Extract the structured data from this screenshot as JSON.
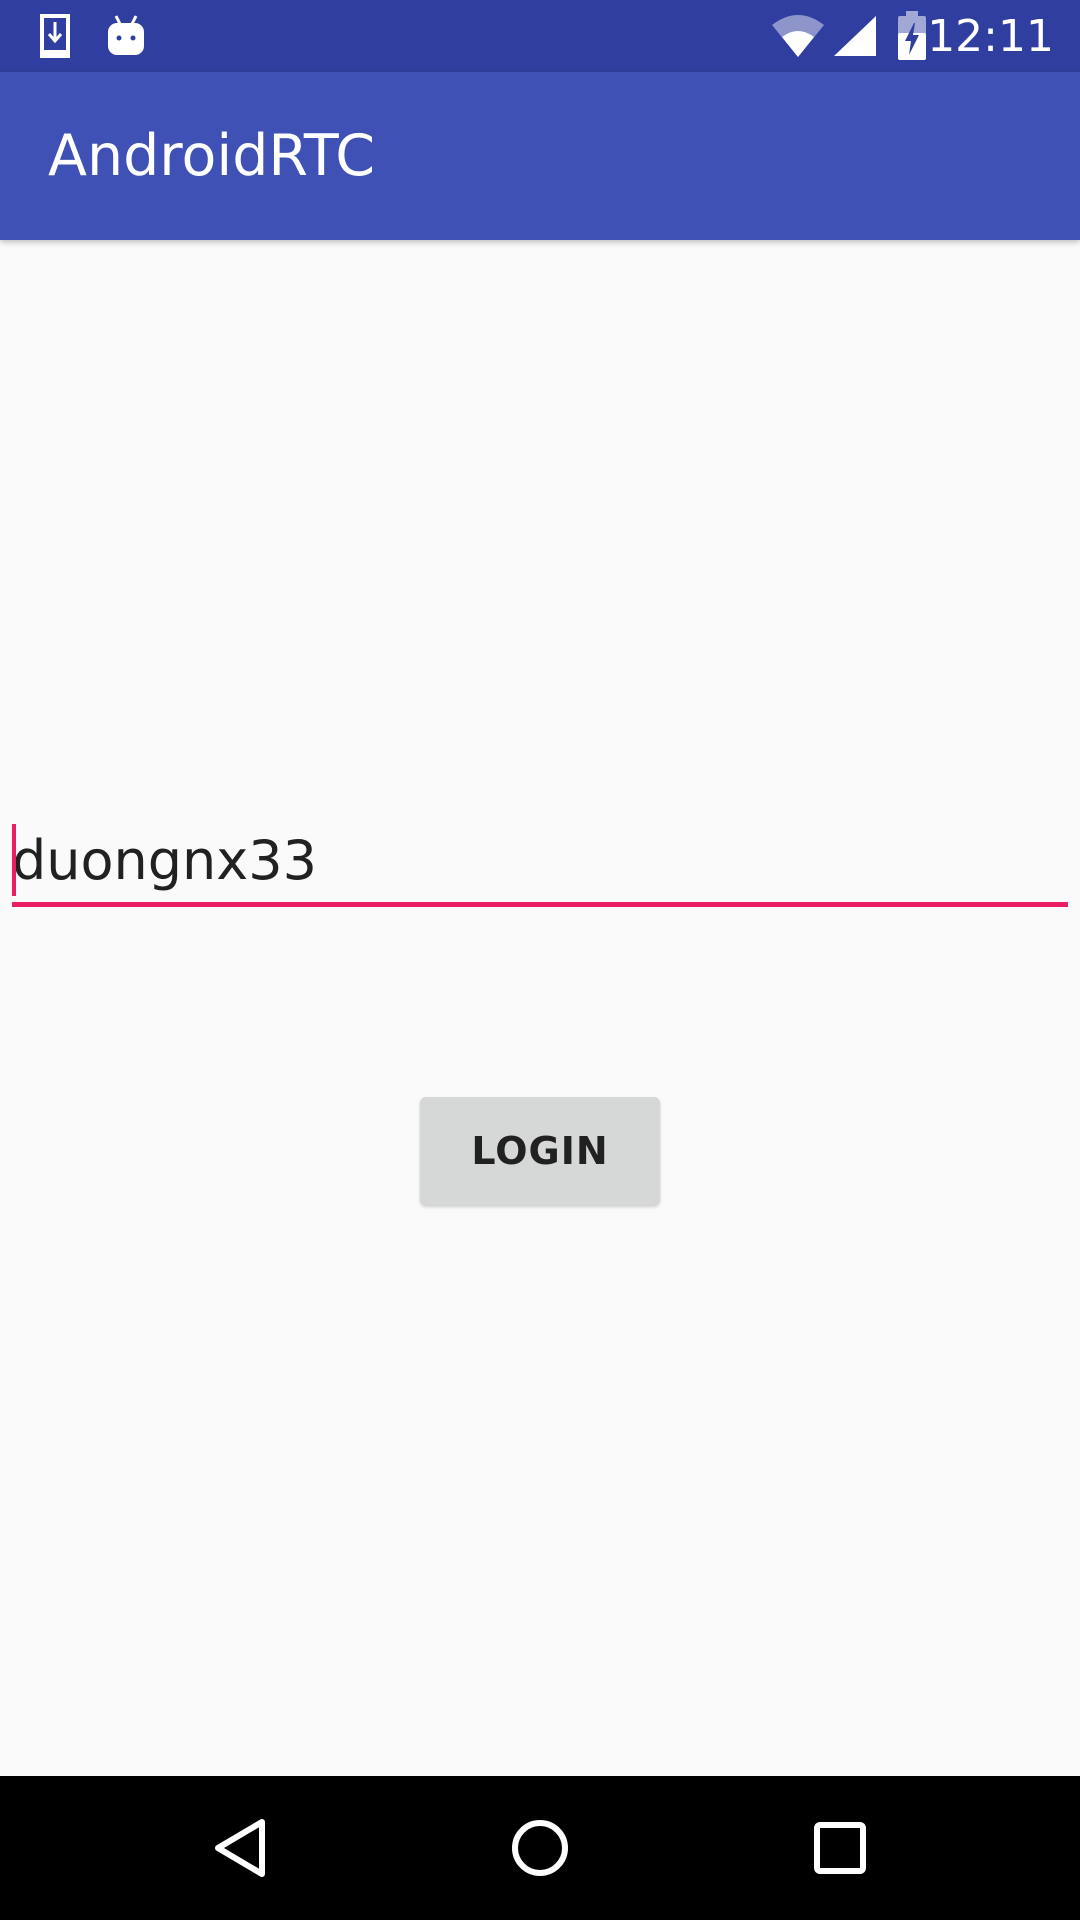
{
  "status_bar": {
    "time": "12:11",
    "icons": [
      "download-icon",
      "android-icon",
      "wifi-icon",
      "signal-icon",
      "battery-charging-icon"
    ],
    "background_color": "#303f9f"
  },
  "app_bar": {
    "title": "AndroidRTC",
    "background_color": "#3f51b5"
  },
  "username_field": {
    "value": "duongnx33",
    "accent_color": "#e91e63"
  },
  "login_button": {
    "label": "LOGIN"
  },
  "nav_bar": {
    "buttons": [
      "back-icon",
      "home-icon",
      "recents-icon"
    ]
  }
}
